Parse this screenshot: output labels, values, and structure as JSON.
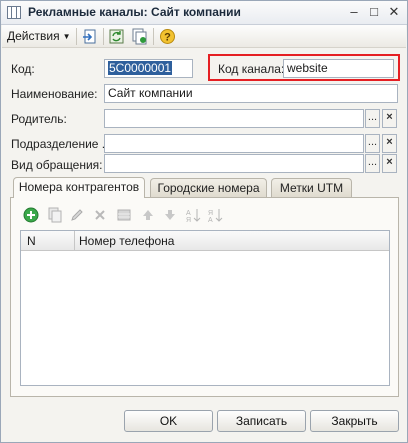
{
  "window": {
    "title": "Рекламные каналы: Сайт компании",
    "controls": {
      "minimize": "–",
      "maximize": "□",
      "close": "✕"
    }
  },
  "toolbar": {
    "actions_label": "Действия",
    "icons": [
      "go-to-icon",
      "refresh-icon",
      "copy-icon",
      "help-icon"
    ]
  },
  "form": {
    "code_label": "Код:",
    "code_value": "5C0000001",
    "channel_code_label": "Код канала:",
    "channel_code_value": "website",
    "name_label": "Наименование:",
    "name_value": "Сайт компании",
    "parent_label": "Родитель:",
    "parent_value": "",
    "department_label": "Подразделение ...",
    "department_value": "",
    "request_type_label": "Вид обращения:",
    "request_type_value": "",
    "select_button": "...",
    "clear_button": "×"
  },
  "tabs": [
    {
      "label": "Номера контрагентов",
      "active": true
    },
    {
      "label": "Городские номера",
      "active": false
    },
    {
      "label": "Метки UTM",
      "active": false
    }
  ],
  "grid": {
    "columns": [
      "N",
      "Номер телефона"
    ]
  },
  "buttons": {
    "ok": "OK",
    "save": "Записать",
    "close": "Закрыть"
  },
  "colors": {
    "highlight": "#e51f23",
    "selection": "#2e5f9c"
  }
}
